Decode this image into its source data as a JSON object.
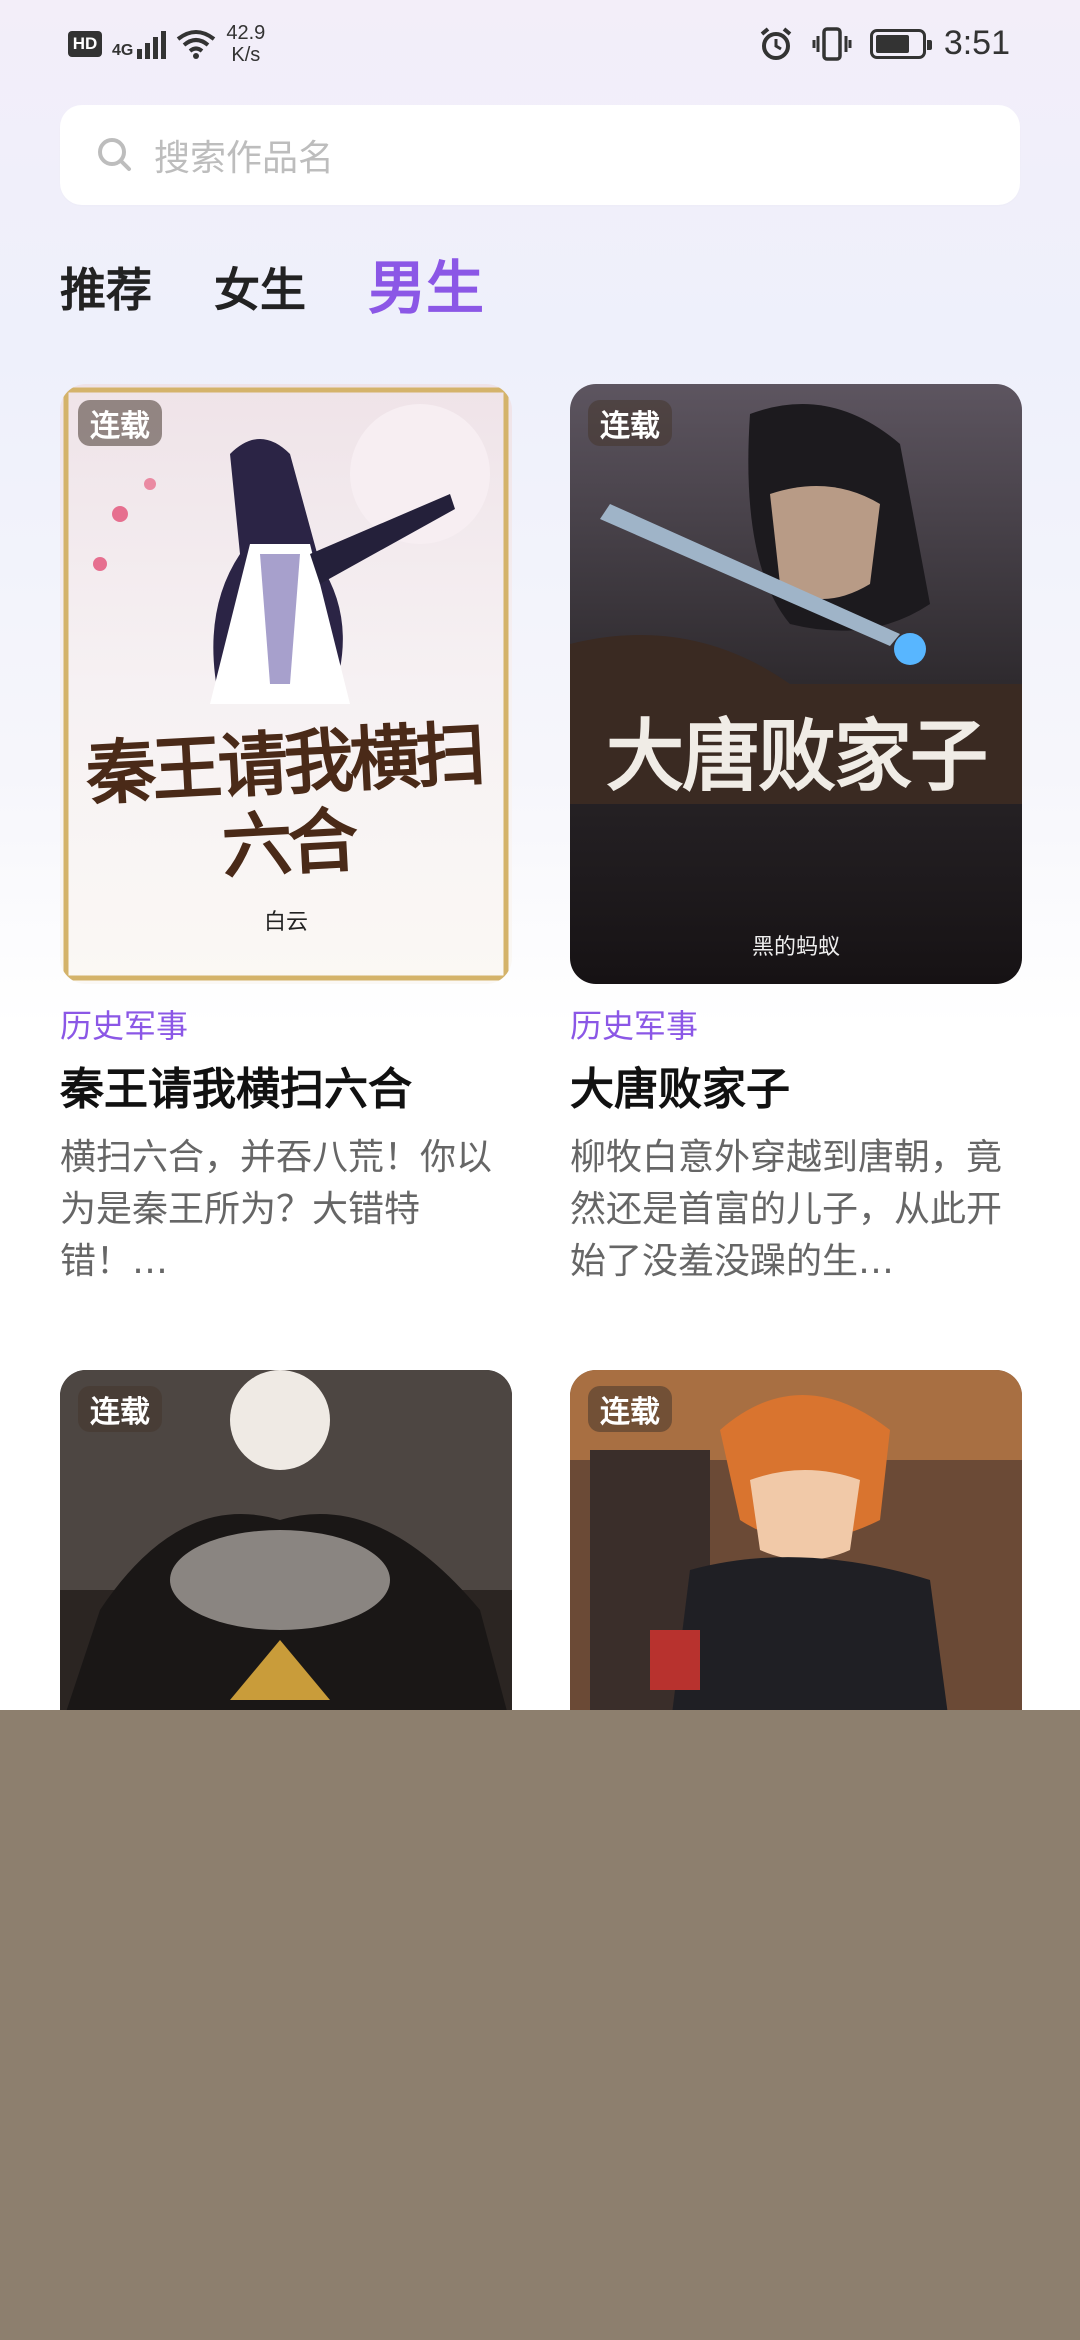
{
  "status_bar": {
    "hd_label": "HD",
    "network_label": "4G",
    "speed_value": "42.9",
    "speed_unit": "K/s",
    "time": "3:51"
  },
  "search": {
    "placeholder": "搜索作品名"
  },
  "tabs": [
    {
      "label": "推荐",
      "active": false
    },
    {
      "label": "女生",
      "active": false
    },
    {
      "label": "男生",
      "active": true
    }
  ],
  "books": [
    {
      "badge": "连载",
      "genre": "历史军事",
      "title": "秦王请我横扫六合",
      "desc": "横扫六合，并吞八荒！你以为是秦王所为？大错特错！…",
      "cover_text": "秦王请我横扫六合",
      "cover_author": "白云"
    },
    {
      "badge": "连载",
      "genre": "历史军事",
      "title": "大唐败家子",
      "desc": "柳牧白意外穿越到唐朝，竟然还是首富的儿子，从此开始了没羞没躁的生…",
      "cover_text": "大唐败家子",
      "cover_author": "黑的蚂蚁"
    },
    {
      "badge": "连载"
    },
    {
      "badge": "连载"
    }
  ],
  "colors": {
    "accent": "#8b57e6",
    "overlay_panel": "#8d7f6e"
  }
}
